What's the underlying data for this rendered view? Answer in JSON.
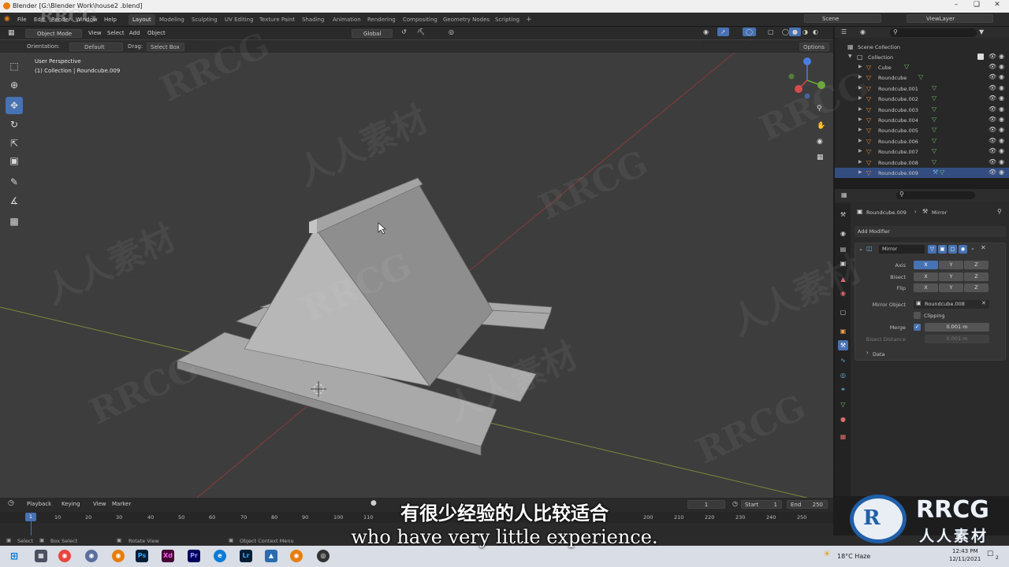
{
  "window": {
    "title": "Blender [G:\\Blender Work\\house2 .blend]"
  },
  "menu": [
    "File",
    "Edit",
    "Render",
    "Window",
    "Help"
  ],
  "workspaces": [
    "Layout",
    "Modeling",
    "Sculpting",
    "UV Editing",
    "Texture Paint",
    "Shading",
    "Animation",
    "Rendering",
    "Compositing",
    "Geometry Nodes",
    "Scripting"
  ],
  "active_workspace": "Layout",
  "scene": "Scene",
  "view_layer": "ViewLayer",
  "viewport_header": {
    "mode": "Object Mode",
    "menus": [
      "View",
      "Select",
      "Add",
      "Object"
    ],
    "transform": "Global",
    "options": "Options"
  },
  "tool_header": {
    "orientation_label": "Orientation:",
    "orientation_value": "Default",
    "drag_label": "Drag:",
    "drag_value": "Select Box"
  },
  "viewport": {
    "perspective": "User Perspective",
    "collection_info": "(1) Collection | Roundcube.009"
  },
  "outliner": {
    "root": "Scene Collection",
    "collection": "Collection",
    "items": [
      "Cube",
      "Roundcube",
      "Roundcube.001",
      "Roundcube.002",
      "Roundcube.003",
      "Roundcube.004",
      "Roundcube.005",
      "Roundcube.006",
      "Roundcube.007",
      "Roundcube.008",
      "Roundcube.009"
    ]
  },
  "properties": {
    "object": "Roundcube.009",
    "modifier_crumb": "Mirror",
    "add_modifier": "Add Modifier",
    "modifier_name": "Mirror",
    "axis_label": "Axis",
    "bisect_label": "Bisect",
    "flip_label": "Flip",
    "x": "X",
    "y": "Y",
    "z": "Z",
    "mirror_object_label": "Mirror Object",
    "mirror_object": "Roundcube.008",
    "clipping_label": "Clipping",
    "merge_label": "Merge",
    "merge_value": "0.001 m",
    "bisect_distance_label": "Bisect Distance",
    "bisect_distance_value": "0.001 m",
    "data_label": "Data"
  },
  "timeline": {
    "menus": [
      "Playback",
      "Keying",
      "View",
      "Marker"
    ],
    "current_frame": "1",
    "start_label": "Start",
    "start": "1",
    "end_label": "End",
    "end": "250",
    "ticks": [
      "1",
      "10",
      "20",
      "30",
      "40",
      "50",
      "60",
      "70",
      "80",
      "90",
      "100",
      "110",
      "200",
      "210",
      "220",
      "230",
      "240",
      "250"
    ]
  },
  "statusbar": {
    "select": "Select",
    "box_select": "Box Select",
    "rotate_view": "Rotate View",
    "context_menu": "Object Context Menu"
  },
  "taskbar": {
    "weather": "18°C  Haze",
    "time": "12:43 PM",
    "date": "12/11/2021",
    "notifications": "2"
  },
  "subtitles": {
    "zh": "有很少经验的人比较适合",
    "en": "who have very little experience."
  },
  "watermark": {
    "brand": "RRCG",
    "brand_cn": "人人素材"
  },
  "colors": {
    "accent": "#4772b3",
    "blender_orange": "#e87d0d",
    "modifier_green": "#6cc35f"
  }
}
